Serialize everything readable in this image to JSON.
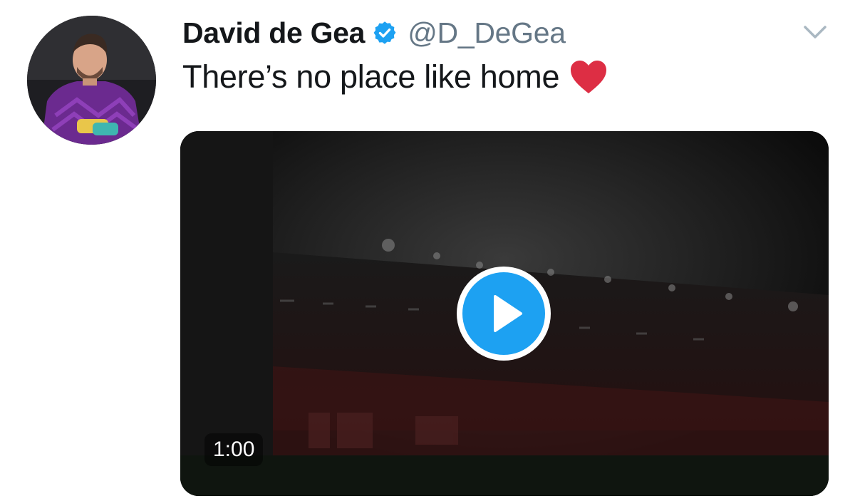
{
  "tweet": {
    "author": {
      "display_name": "David de Gea",
      "handle": "@D_DeGea",
      "verified": true,
      "avatar_icon": "profile-photo"
    },
    "text": "There’s no place like home",
    "emoji": "red-heart",
    "menu_icon": "chevron-down-icon",
    "media": {
      "type": "video",
      "duration": "1:00",
      "play_icon": "play-icon"
    }
  },
  "colors": {
    "accent": "#1da1f2",
    "text": "#14171a",
    "muted": "#657786",
    "heart": "#e0245e"
  }
}
